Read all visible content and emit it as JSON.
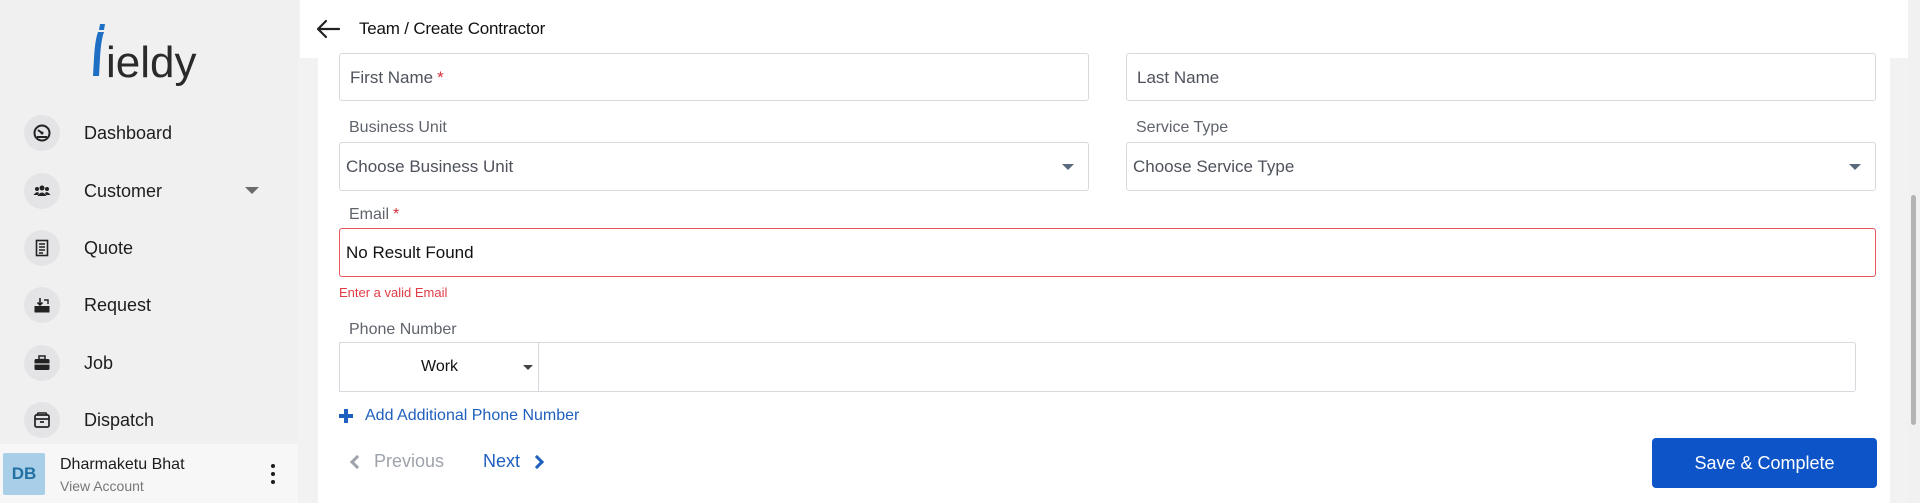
{
  "app": {
    "brand": "fieldy",
    "brand_color": "#1f6fc4"
  },
  "sidebar": {
    "items": [
      {
        "label": "Dashboard",
        "icon": "dashboard-gauge-icon"
      },
      {
        "label": "Customer",
        "icon": "users-icon",
        "expandable": true
      },
      {
        "label": "Quote",
        "icon": "document-icon"
      },
      {
        "label": "Request",
        "icon": "request-inbox-icon"
      },
      {
        "label": "Job",
        "icon": "briefcase-icon"
      },
      {
        "label": "Dispatch",
        "icon": "dispatch-box-icon"
      }
    ],
    "user": {
      "initials": "DB",
      "name": "Dharmaketu Bhat",
      "sub": "View Account"
    }
  },
  "header": {
    "breadcrumb": "Team / Create Contractor"
  },
  "form": {
    "first_name": {
      "placeholder": "First Name",
      "required": "*"
    },
    "last_name": {
      "placeholder": "Last Name"
    },
    "business_unit": {
      "label": "Business Unit",
      "placeholder": "Choose Business Unit"
    },
    "service_type": {
      "label": "Service Type",
      "placeholder": "Choose Service Type"
    },
    "email": {
      "label": "Email",
      "required": "*",
      "value": "No Result Found",
      "error": "Enter a valid Email"
    },
    "phone": {
      "label": "Phone Number",
      "type_value": "Work",
      "value": ""
    },
    "add_phone_label": "Add Additional Phone Number"
  },
  "footer": {
    "previous_label": "Previous",
    "next_label": "Next",
    "save_label": "Save & Complete"
  },
  "colors": {
    "accent": "#0d54c9",
    "error": "#e03b45",
    "link": "#1f5fbe"
  }
}
